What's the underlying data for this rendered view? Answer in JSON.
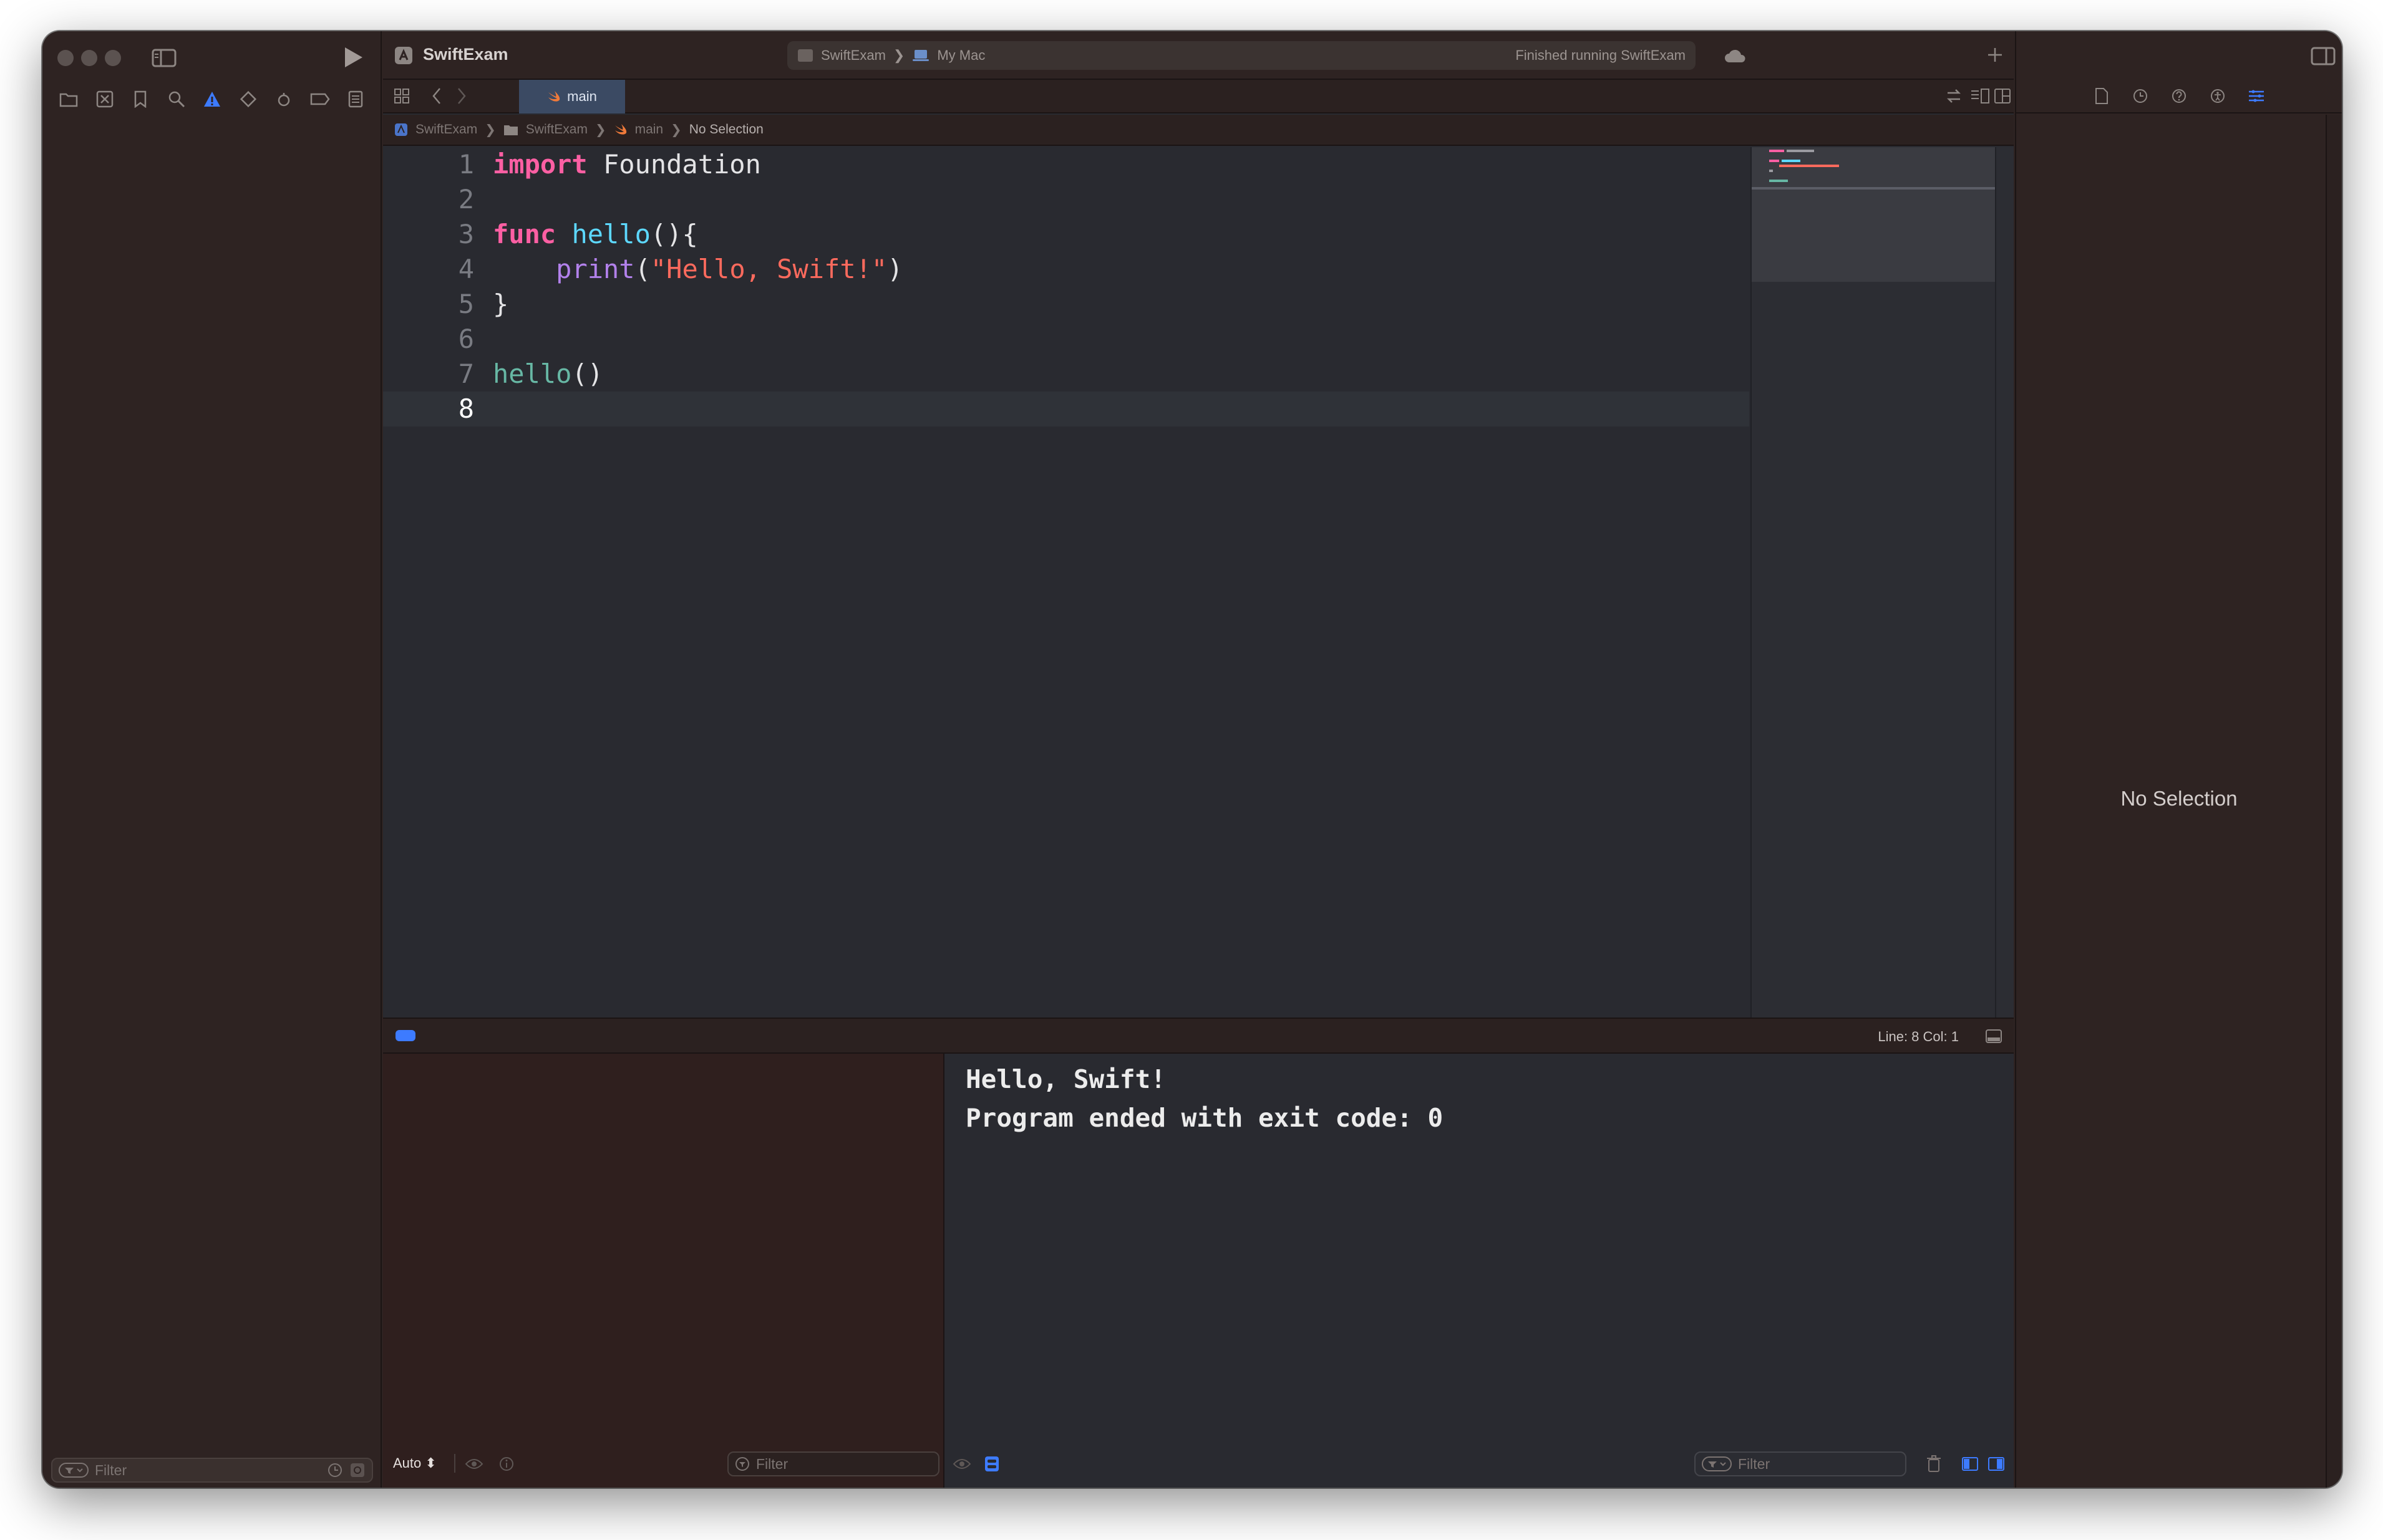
{
  "window": {
    "title": "SwiftExam"
  },
  "toolbar": {
    "scheme": "SwiftExam",
    "destination": "My Mac",
    "status": "Finished running SwiftExam"
  },
  "editor": {
    "tab_label": "main",
    "breadcrumb": [
      "SwiftExam",
      "SwiftExam",
      "main",
      "No Selection"
    ],
    "lines": [
      {
        "number": "1",
        "text": "import Foundation"
      },
      {
        "number": "2",
        "text": ""
      },
      {
        "number": "3",
        "text": "func hello(){"
      },
      {
        "number": "4",
        "text": "    print(\"Hello, Swift!\")"
      },
      {
        "number": "5",
        "text": "}"
      },
      {
        "number": "6",
        "text": ""
      },
      {
        "number": "7",
        "text": "hello()"
      },
      {
        "number": "8",
        "text": ""
      }
    ],
    "current_line": "8",
    "cursor_position": "Line: 8  Col: 1"
  },
  "debug": {
    "scope_selector": "Auto",
    "variables_filter_placeholder": "Filter",
    "console_filter_placeholder": "Filter",
    "console_output": [
      "Hello, Swift!",
      "Program ended with exit code: 0"
    ]
  },
  "navigator": {
    "filter_placeholder": "Filter"
  },
  "inspector": {
    "empty_text": "No Selection"
  },
  "colors": {
    "keyword": "#fc5fa3",
    "function_decl": "#5dd8ff",
    "function_call": "#67b7a4",
    "builtin_call": "#b281eb",
    "string": "#fc6a5d",
    "accent": "#3d7bff"
  }
}
